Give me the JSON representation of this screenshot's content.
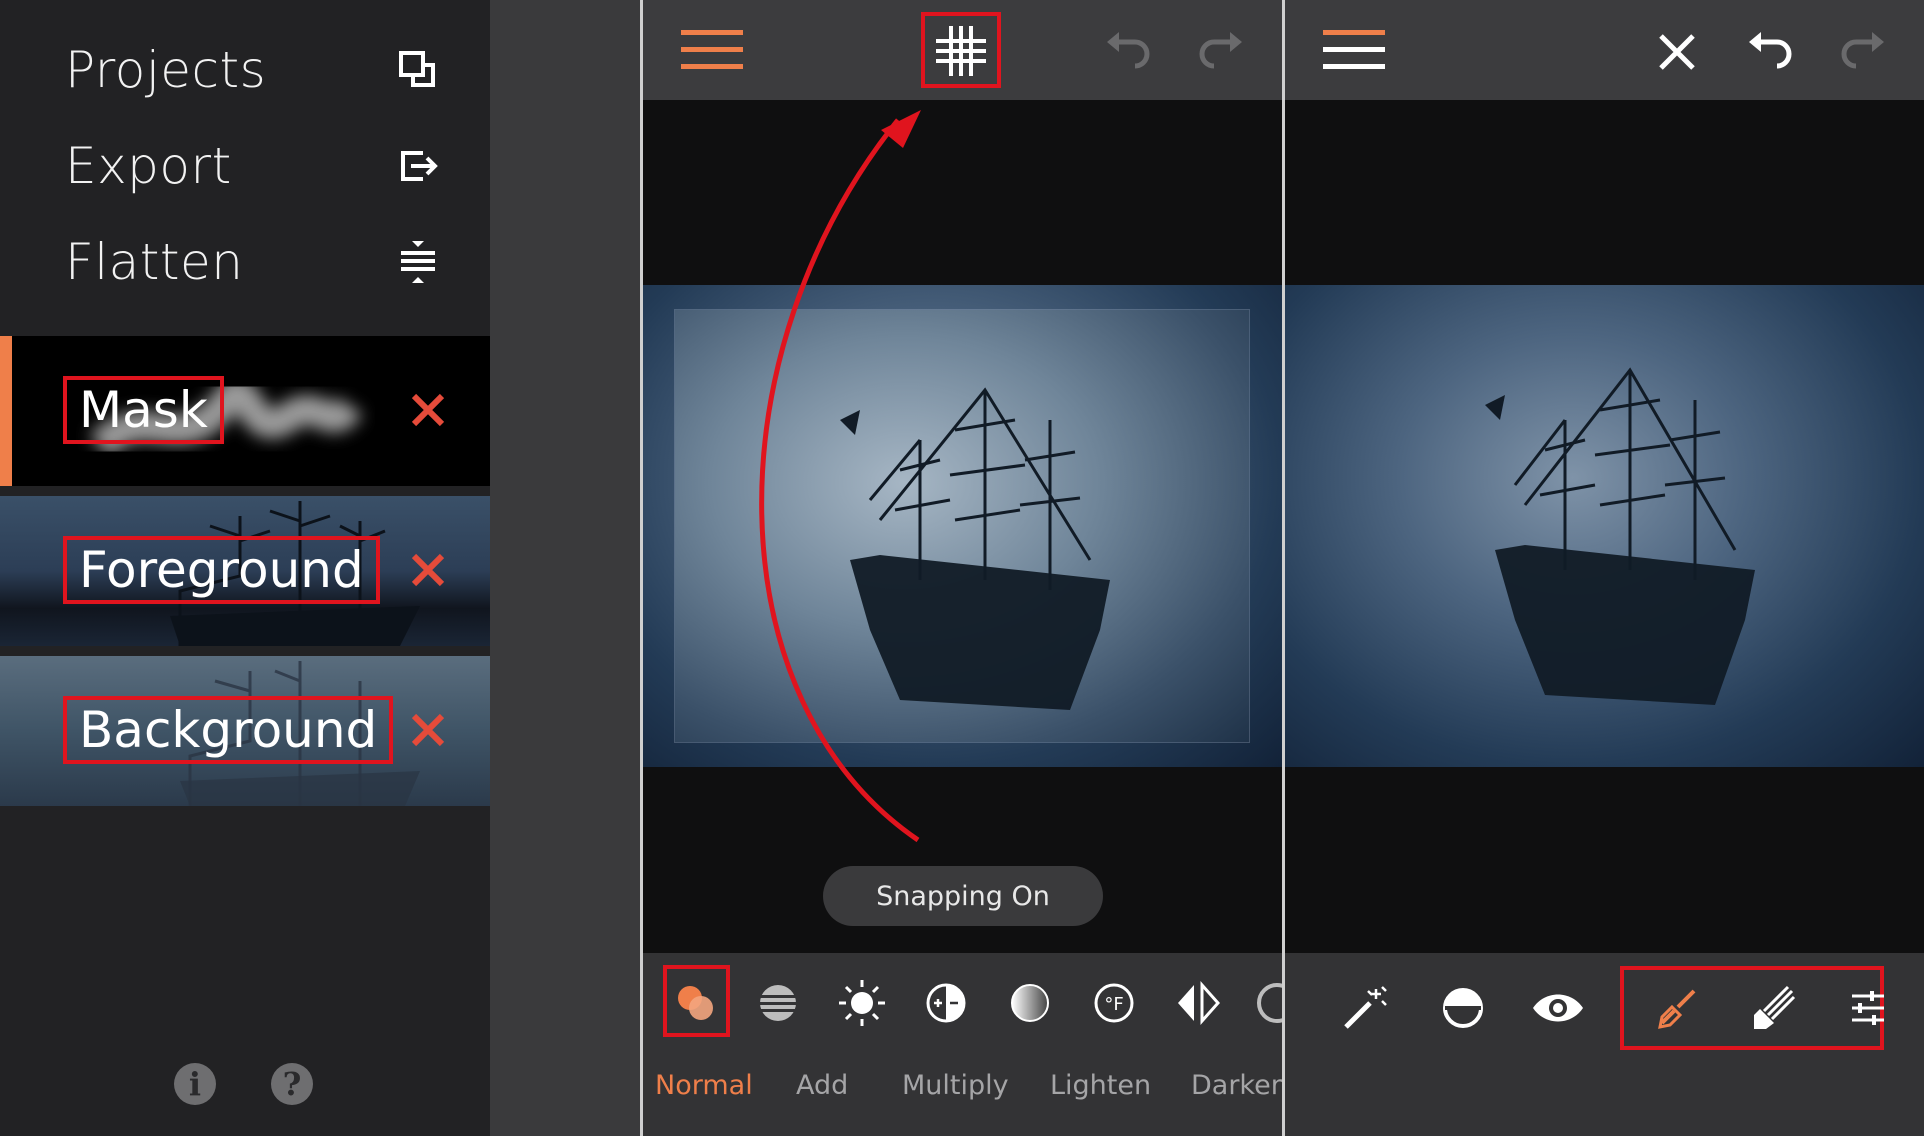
{
  "left_panel": {
    "menu": [
      {
        "label": "Projects",
        "icon": "projects-icon"
      },
      {
        "label": "Export",
        "icon": "export-icon"
      },
      {
        "label": "Flatten",
        "icon": "flatten-icon"
      }
    ],
    "layers": [
      {
        "label": "Mask",
        "active": true,
        "close_icon": "close-icon"
      },
      {
        "label": "Foreground",
        "active": false,
        "close_icon": "close-icon"
      },
      {
        "label": "Background",
        "active": false,
        "close_icon": "close-icon"
      }
    ],
    "bottom_icons": [
      {
        "icon": "info-icon",
        "glyph": "i"
      },
      {
        "icon": "help-icon",
        "glyph": "?"
      }
    ]
  },
  "middle_panel": {
    "toolbar_icons": [
      "menu-icon",
      "grid-snap-icon",
      "undo-icon",
      "redo-icon"
    ],
    "snapping_status": "Snapping On",
    "blend_modes": [
      {
        "label": "Normal",
        "icon": "normal-blend-icon",
        "active": true
      },
      {
        "label": "Add",
        "icon": "add-blend-icon",
        "active": false
      },
      {
        "label": "Multiply",
        "icon": "multiply-blend-icon",
        "active": false
      },
      {
        "label": "Lighten",
        "icon": "lighten-blend-icon",
        "active": false
      },
      {
        "label": "Darken",
        "icon": "darken-blend-icon",
        "active": false
      }
    ],
    "adjust_icons": [
      "exposure-icon",
      "contrast-icon",
      "gradient-icon",
      "temperature-icon",
      "mirror-icon"
    ]
  },
  "right_panel": {
    "toolbar_icons": [
      "menu-icon",
      "close-icon",
      "undo-icon",
      "redo-icon"
    ],
    "tools": [
      "magic-wand-icon",
      "invert-mask-icon",
      "visibility-eye-icon",
      "brush-icon",
      "eraser-brush-icon",
      "adjust-sliders-icon"
    ]
  },
  "colors": {
    "accent": "#ef7f4a",
    "highlight_box": "#e0141e",
    "close_x": "#e54b3a",
    "panel_bg": "#222224",
    "toolbar_bg": "#3c3c3e"
  }
}
